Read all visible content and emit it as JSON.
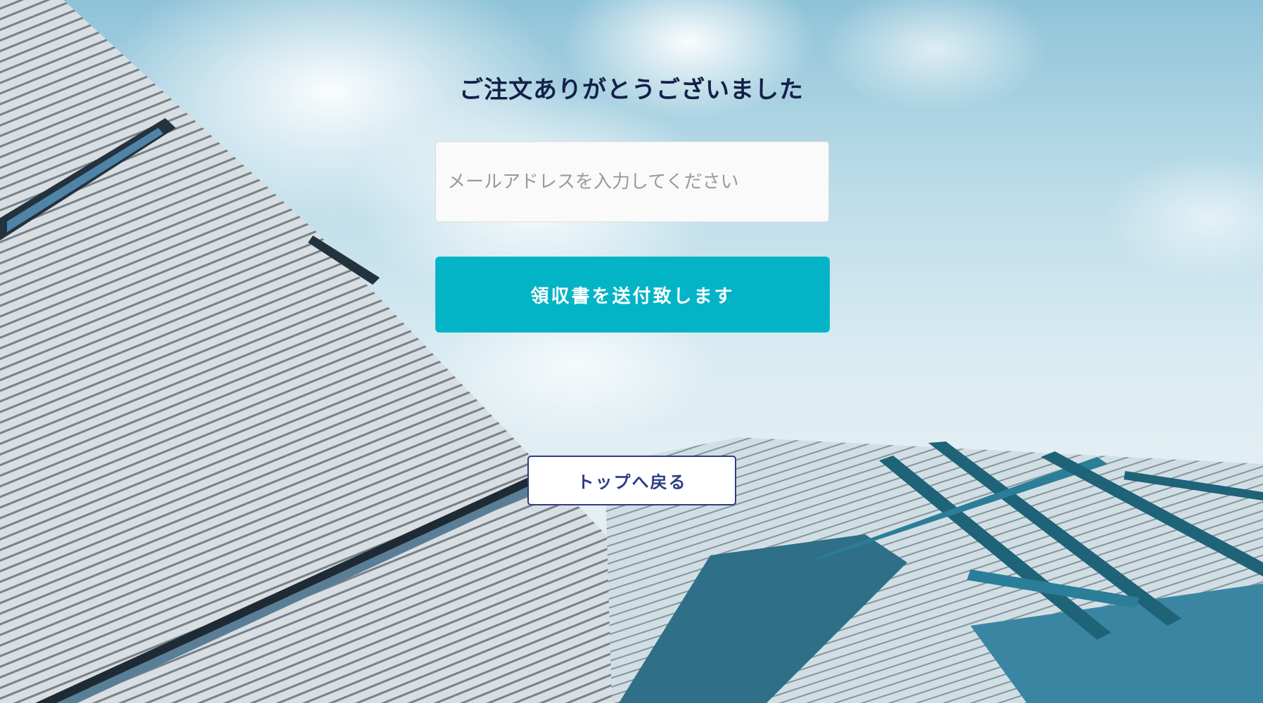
{
  "title": "ご注文ありがとうございました",
  "email": {
    "placeholder": "メールアドレスを入力してください",
    "value": ""
  },
  "buttons": {
    "send_receipt_label": "領収書を送付致します",
    "back_to_top_label": "トップへ戻る"
  },
  "colors": {
    "title": "#14204a",
    "accent": "#03b4c6",
    "outline_button": "#2d3c86",
    "background_sky": "#b9dbe8"
  }
}
